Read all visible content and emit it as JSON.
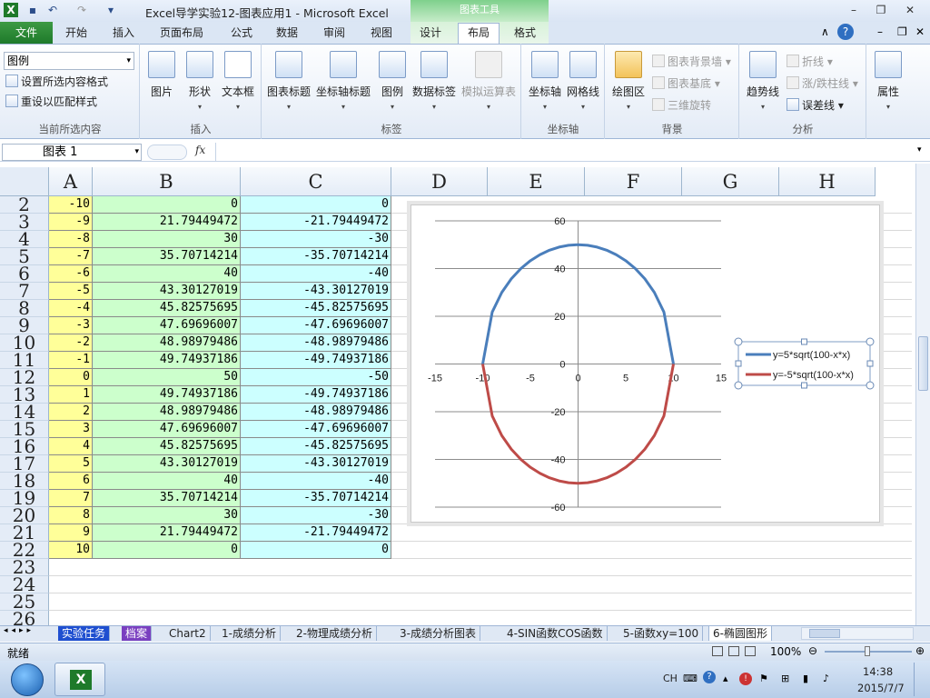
{
  "window": {
    "title": "Excel导学实验12-图表应用1  -  Microsoft Excel",
    "context_group": "图表工具"
  },
  "tabs": {
    "file": "文件",
    "items": [
      "开始",
      "插入",
      "页面布局",
      "公式",
      "数据",
      "审阅",
      "视图",
      "设计",
      "布局",
      "格式"
    ],
    "active": "布局"
  },
  "ribbon": {
    "current_selection": {
      "dropdown_value": "图例",
      "format_selection": "设置所选内容格式",
      "reset_style": "重设以匹配样式",
      "group_label": "当前所选内容"
    },
    "insert": {
      "picture": "图片",
      "shapes": "形状",
      "textbox": "文本框",
      "group_label": "插入"
    },
    "labels": {
      "chart_title": "图表标题",
      "axis_titles": "坐标轴标题",
      "legend": "图例",
      "data_labels": "数据标签",
      "data_table": "模拟运算表",
      "group_label": "标签"
    },
    "axes": {
      "axes": "坐标轴",
      "gridlines": "网格线",
      "group_label": "坐标轴"
    },
    "background": {
      "plot_area": "绘图区",
      "chart_wall": "图表背景墙",
      "chart_floor": "图表基底",
      "rotation": "三维旋转",
      "group_label": "背景"
    },
    "analysis": {
      "trendline": "趋势线",
      "lines": "折线",
      "updown_bars": "涨/跌柱线",
      "error_bars": "误差线",
      "group_label": "分析"
    },
    "properties": {
      "label": "属性"
    }
  },
  "formula_bar": {
    "name_box": "图表 1",
    "fx": "fx",
    "value": ""
  },
  "grid": {
    "columns": [
      "A",
      "B",
      "C",
      "D",
      "E",
      "F",
      "G",
      "H"
    ],
    "row_numbers": [
      "2",
      "3",
      "4",
      "5",
      "6",
      "7",
      "8",
      "9",
      "10",
      "11",
      "12",
      "13",
      "14",
      "15",
      "16",
      "17",
      "18",
      "19",
      "20",
      "21",
      "22",
      "23",
      "24",
      "25",
      "26"
    ],
    "rows": [
      [
        "-10",
        "0",
        "0"
      ],
      [
        "-9",
        "21.79449472",
        "-21.79449472"
      ],
      [
        "-8",
        "30",
        "-30"
      ],
      [
        "-7",
        "35.70714214",
        "-35.70714214"
      ],
      [
        "-6",
        "40",
        "-40"
      ],
      [
        "-5",
        "43.30127019",
        "-43.30127019"
      ],
      [
        "-4",
        "45.82575695",
        "-45.82575695"
      ],
      [
        "-3",
        "47.69696007",
        "-47.69696007"
      ],
      [
        "-2",
        "48.98979486",
        "-48.98979486"
      ],
      [
        "-1",
        "49.74937186",
        "-49.74937186"
      ],
      [
        "0",
        "50",
        "-50"
      ],
      [
        "1",
        "49.74937186",
        "-49.74937186"
      ],
      [
        "2",
        "48.98979486",
        "-48.98979486"
      ],
      [
        "3",
        "47.69696007",
        "-47.69696007"
      ],
      [
        "4",
        "45.82575695",
        "-45.82575695"
      ],
      [
        "5",
        "43.30127019",
        "-43.30127019"
      ],
      [
        "6",
        "40",
        "-40"
      ],
      [
        "7",
        "35.70714214",
        "-35.70714214"
      ],
      [
        "8",
        "30",
        "-30"
      ],
      [
        "9",
        "21.79449472",
        "-21.79449472"
      ],
      [
        "10",
        "0",
        "0"
      ]
    ],
    "colors": {
      "a": "#ffff99",
      "b_odd": "#ccffcc",
      "c_odd": "#ccffff",
      "b_even": "#ccffcc",
      "c_even": "#ccffff"
    }
  },
  "chart_data": {
    "type": "line",
    "x": [
      -10,
      -9,
      -8,
      -7,
      -6,
      -5,
      -4,
      -3,
      -2,
      -1,
      0,
      1,
      2,
      3,
      4,
      5,
      6,
      7,
      8,
      9,
      10
    ],
    "series": [
      {
        "name": "y=5*sqrt(100-x*x)",
        "color": "#4a7ebb",
        "values": [
          0,
          21.79449472,
          30,
          35.70714214,
          40,
          43.30127019,
          45.82575695,
          47.69696007,
          48.98979486,
          49.74937186,
          50,
          49.74937186,
          48.98979486,
          47.69696007,
          45.82575695,
          43.30127019,
          40,
          35.70714214,
          30,
          21.79449472,
          0
        ]
      },
      {
        "name": "y=-5*sqrt(100-x*x)",
        "color": "#be4b48",
        "values": [
          0,
          -21.79449472,
          -30,
          -35.70714214,
          -40,
          -43.30127019,
          -45.82575695,
          -47.69696007,
          -48.98979486,
          -49.74937186,
          -50,
          -49.74937186,
          -48.98979486,
          -47.69696007,
          -45.82575695,
          -43.30127019,
          -40,
          -35.70714214,
          -30,
          -21.79449472,
          0
        ]
      }
    ],
    "xlim": [
      -15,
      15
    ],
    "ylim": [
      -60,
      60
    ],
    "xticks": [
      "-15",
      "-10",
      "-5",
      "0",
      "5",
      "10",
      "15"
    ],
    "yticks": [
      "60",
      "40",
      "20",
      "0",
      "-20",
      "-40",
      "-60"
    ],
    "grid": "horizontal",
    "legend": "right",
    "title": "",
    "xlabel": "",
    "ylabel": ""
  },
  "sheet_tabs": [
    "实验任务",
    "档案",
    "Chart2",
    "1-成绩分析",
    "2-物理成绩分析",
    "3-成绩分析图表",
    "4-SIN函数COS函数",
    "5-函数xy=100",
    "6-椭圆图形"
  ],
  "status": {
    "ready": "就绪",
    "zoom": "100%"
  },
  "taskbar": {
    "lang": "CH",
    "time": "14:38",
    "date": "2015/7/7"
  }
}
